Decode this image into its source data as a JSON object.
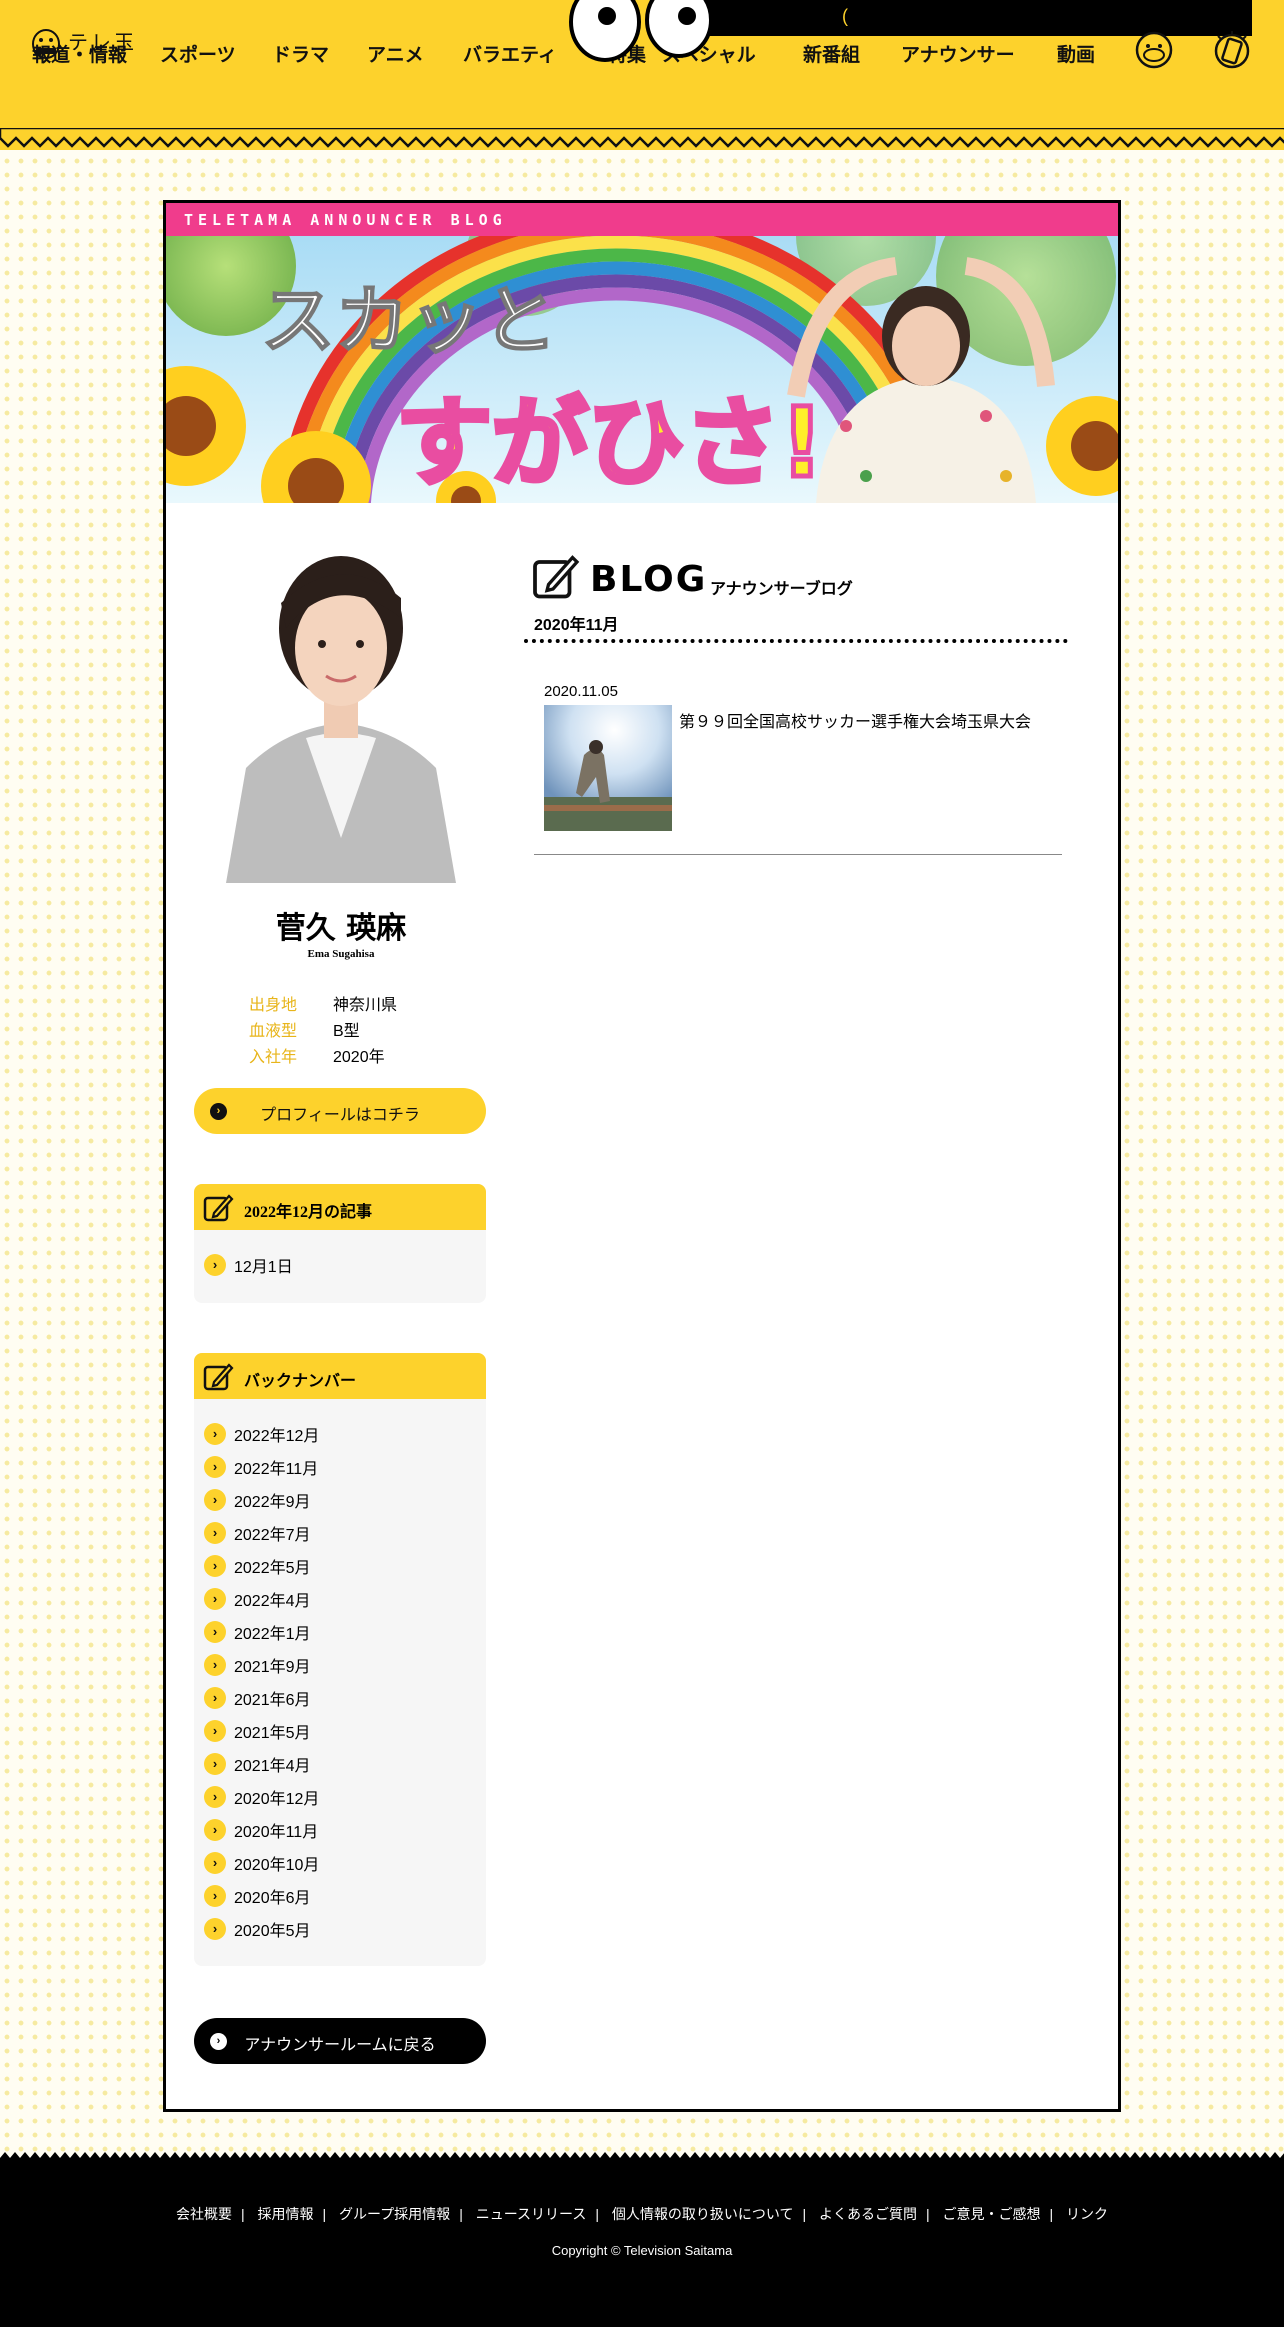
{
  "header": {
    "logo_text": "テレ玉",
    "nav": [
      "報道・情報",
      "スポーツ",
      "ドラマ",
      "アニメ",
      "バラエティ",
      "特集",
      "スペシャル",
      "新番組",
      "アナウンサー",
      "動画"
    ],
    "banner_text": "(",
    "colors": {
      "brand_yellow": "#fdd22c",
      "accent_pink": "#f03c8c",
      "black": "#000000"
    }
  },
  "blog_header": {
    "strip_text": "TELETAMA ANNOUNCER BLOG",
    "hero_title_top": "スカッと",
    "hero_title_main": "すがひさ!"
  },
  "profile": {
    "name": "菅久 瑛麻",
    "name_roman": "Ema Sugahisa",
    "details": [
      {
        "label": "出身地",
        "value": "神奈川県"
      },
      {
        "label": "血液型",
        "value": "B型"
      },
      {
        "label": "入社年",
        "value": "2020年"
      }
    ],
    "profile_button": "プロフィールはコチラ"
  },
  "recent": {
    "title": "2022年12月の記事",
    "items": [
      "12月1日"
    ]
  },
  "backnumber": {
    "title": "バックナンバー",
    "items": [
      "2022年12月",
      "2022年11月",
      "2022年9月",
      "2022年7月",
      "2022年5月",
      "2022年4月",
      "2022年1月",
      "2021年9月",
      "2021年6月",
      "2021年5月",
      "2021年4月",
      "2020年12月",
      "2020年11月",
      "2020年10月",
      "2020年6月",
      "2020年5月"
    ]
  },
  "back_button": "アナウンサールームに戻る",
  "blog": {
    "title": "BLOG",
    "subtitle": "アナウンサーブログ",
    "month": "2020年11月",
    "posts": [
      {
        "date": "2020.11.05",
        "title": "第９９回全国高校サッカー選手権大会埼玉県大会"
      }
    ]
  },
  "footer": {
    "links": [
      "会社概要",
      "採用情報",
      "グループ採用情報",
      "ニュースリリース",
      "個人情報の取り扱いについて",
      "よくあるご質問",
      "ご意見・ご感想",
      "リンク"
    ],
    "copyright": "Copyright © Television Saitama"
  }
}
